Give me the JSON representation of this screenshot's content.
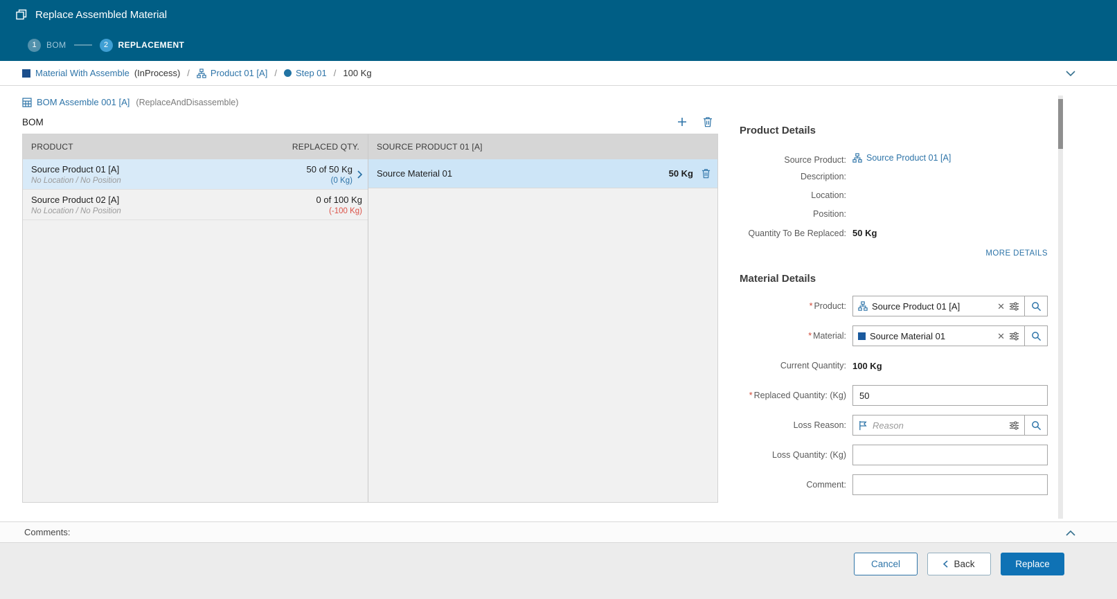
{
  "colors": {
    "header_bg": "#005e85",
    "accent_link": "#2e74a8",
    "primary_button": "#0f72b5",
    "selected_row": "#d8eaf8",
    "negative_delta": "#db5147",
    "table_header_bg": "#d6d6d6"
  },
  "header": {
    "title": "Replace Assembled Material",
    "steps": [
      {
        "number": "1",
        "label": "BOM"
      },
      {
        "number": "2",
        "label": "REPLACEMENT"
      }
    ]
  },
  "breadcrumb": {
    "material": "Material With Assemble",
    "material_status": "(InProcess)",
    "separator": "/",
    "product": "Product 01 [A]",
    "step": "Step 01",
    "quantity": "100 Kg"
  },
  "bom": {
    "title": "BOM Assemble 001 [A]",
    "subtitle": "(ReplaceAndDisassemble)",
    "label": "BOM",
    "left_table": {
      "columns": [
        "PRODUCT",
        "REPLACED QTY."
      ],
      "rows": [
        {
          "product": "Source Product 01 [A]",
          "location": "No Location / No Position",
          "replaced": "50 of 50 Kg",
          "delta": "(0 Kg)"
        },
        {
          "product": "Source Product 02 [A]",
          "location": "No Location / No Position",
          "replaced": "0 of 100 Kg",
          "delta": "(-100 Kg)"
        }
      ]
    },
    "right_table": {
      "column": "SOURCE PRODUCT 01 [A]",
      "rows": [
        {
          "material": "Source Material 01",
          "qty": "50 Kg"
        }
      ]
    }
  },
  "product_details": {
    "title": "Product Details",
    "rows": [
      {
        "label": "Source Product:",
        "value": "Source Product 01 [A]"
      },
      {
        "label": "Description:",
        "value": ""
      },
      {
        "label": "Location:",
        "value": ""
      },
      {
        "label": "Position:",
        "value": ""
      },
      {
        "label": "Quantity To Be Replaced:",
        "value": "50 Kg"
      }
    ],
    "more_details": "MORE DETAILS"
  },
  "material_details": {
    "title": "Material Details",
    "required_marker": "*",
    "product": {
      "label": "Product:",
      "value": "Source Product 01 [A]"
    },
    "material": {
      "label": "Material:",
      "value": "Source Material 01"
    },
    "current_quantity": {
      "label": "Current Quantity:",
      "value": "100 Kg"
    },
    "replaced_quantity": {
      "label": "Replaced Quantity: (Kg)",
      "value": "50"
    },
    "loss_reason": {
      "label": "Loss Reason:",
      "placeholder": "Reason"
    },
    "loss_quantity": {
      "label": "Loss Quantity: (Kg)",
      "value": ""
    },
    "comment": {
      "label": "Comment:",
      "value": ""
    }
  },
  "comments": {
    "label": "Comments:"
  },
  "footer": {
    "cancel_label": "Cancel",
    "back_label": "Back",
    "replace_label": "Replace"
  }
}
